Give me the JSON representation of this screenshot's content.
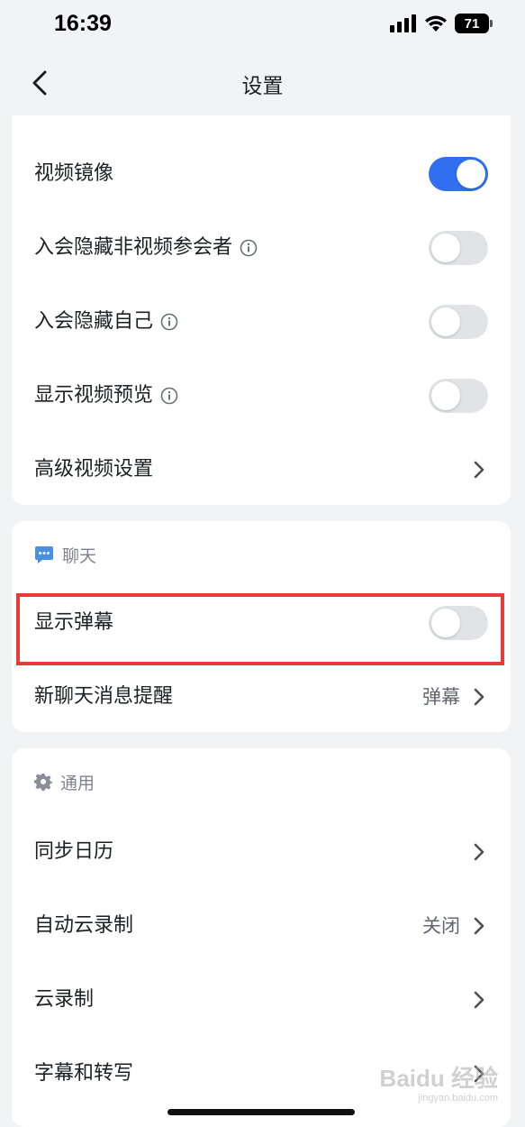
{
  "status_bar": {
    "time": "16:39",
    "battery": "71"
  },
  "nav": {
    "title": "设置"
  },
  "video_section": {
    "rows": [
      {
        "label": "视频镜像",
        "type": "toggle",
        "on": true
      },
      {
        "label": "入会隐藏非视频参会者",
        "type": "toggle",
        "on": false,
        "info": true
      },
      {
        "label": "入会隐藏自己",
        "type": "toggle",
        "on": false,
        "info": true
      },
      {
        "label": "显示视频预览",
        "type": "toggle",
        "on": false,
        "info": true
      },
      {
        "label": "高级视频设置",
        "type": "link"
      }
    ]
  },
  "chat_section": {
    "header": "聊天",
    "rows": [
      {
        "label": "显示弹幕",
        "type": "toggle",
        "on": false
      },
      {
        "label": "新聊天消息提醒",
        "type": "link",
        "value": "弹幕"
      }
    ]
  },
  "general_section": {
    "header": "通用",
    "rows": [
      {
        "label": "同步日历",
        "type": "link"
      },
      {
        "label": "自动云录制",
        "type": "link",
        "value": "关闭"
      },
      {
        "label": "云录制",
        "type": "link"
      },
      {
        "label": "字幕和转写",
        "type": "link"
      }
    ]
  },
  "colors": {
    "accent": "#2f6ff0",
    "highlight": "#ea3a3a",
    "chat_icon": "#4a90e2"
  },
  "watermark": {
    "text": "Baidu 经验",
    "sub": "jingyan.baidu.com"
  }
}
